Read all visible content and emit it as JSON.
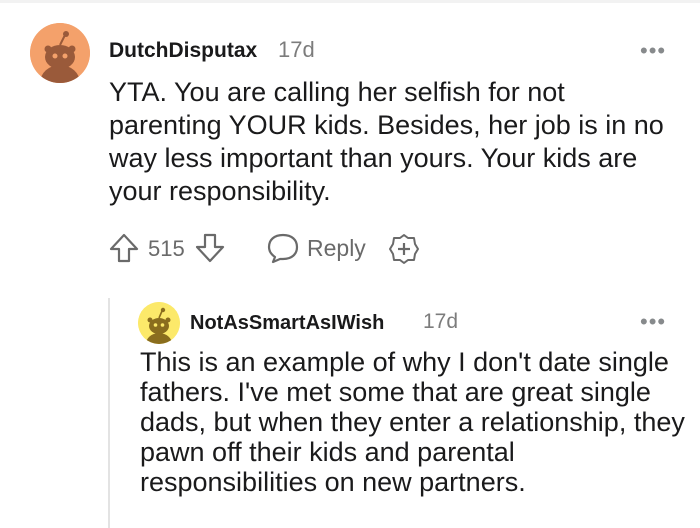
{
  "comments": [
    {
      "username": "DutchDisputax",
      "time": "17d",
      "more": "•••",
      "text": "YTA. You are calling her selfish for not parenting YOUR kids. Besides, her job is in no way less important than yours. Your kids are your responsibility.",
      "votes": "515",
      "reply_label": "Reply",
      "avatar_color": "#f4a16b"
    },
    {
      "username": "NotAsSmartAsIWish",
      "time": "17d",
      "more": "•••",
      "text": "This is an example of why I don't date single fathers. I've met some that are great single dads, but when they enter a relationship, they pawn off their kids and parental responsibilities on new partners.",
      "avatar_color": "#fce96a"
    }
  ],
  "icons": {
    "upvote": "upvote-arrow-icon",
    "downvote": "downvote-arrow-icon",
    "reply": "speech-bubble-icon",
    "award": "award-plus-icon",
    "more": "ellipsis-icon"
  }
}
